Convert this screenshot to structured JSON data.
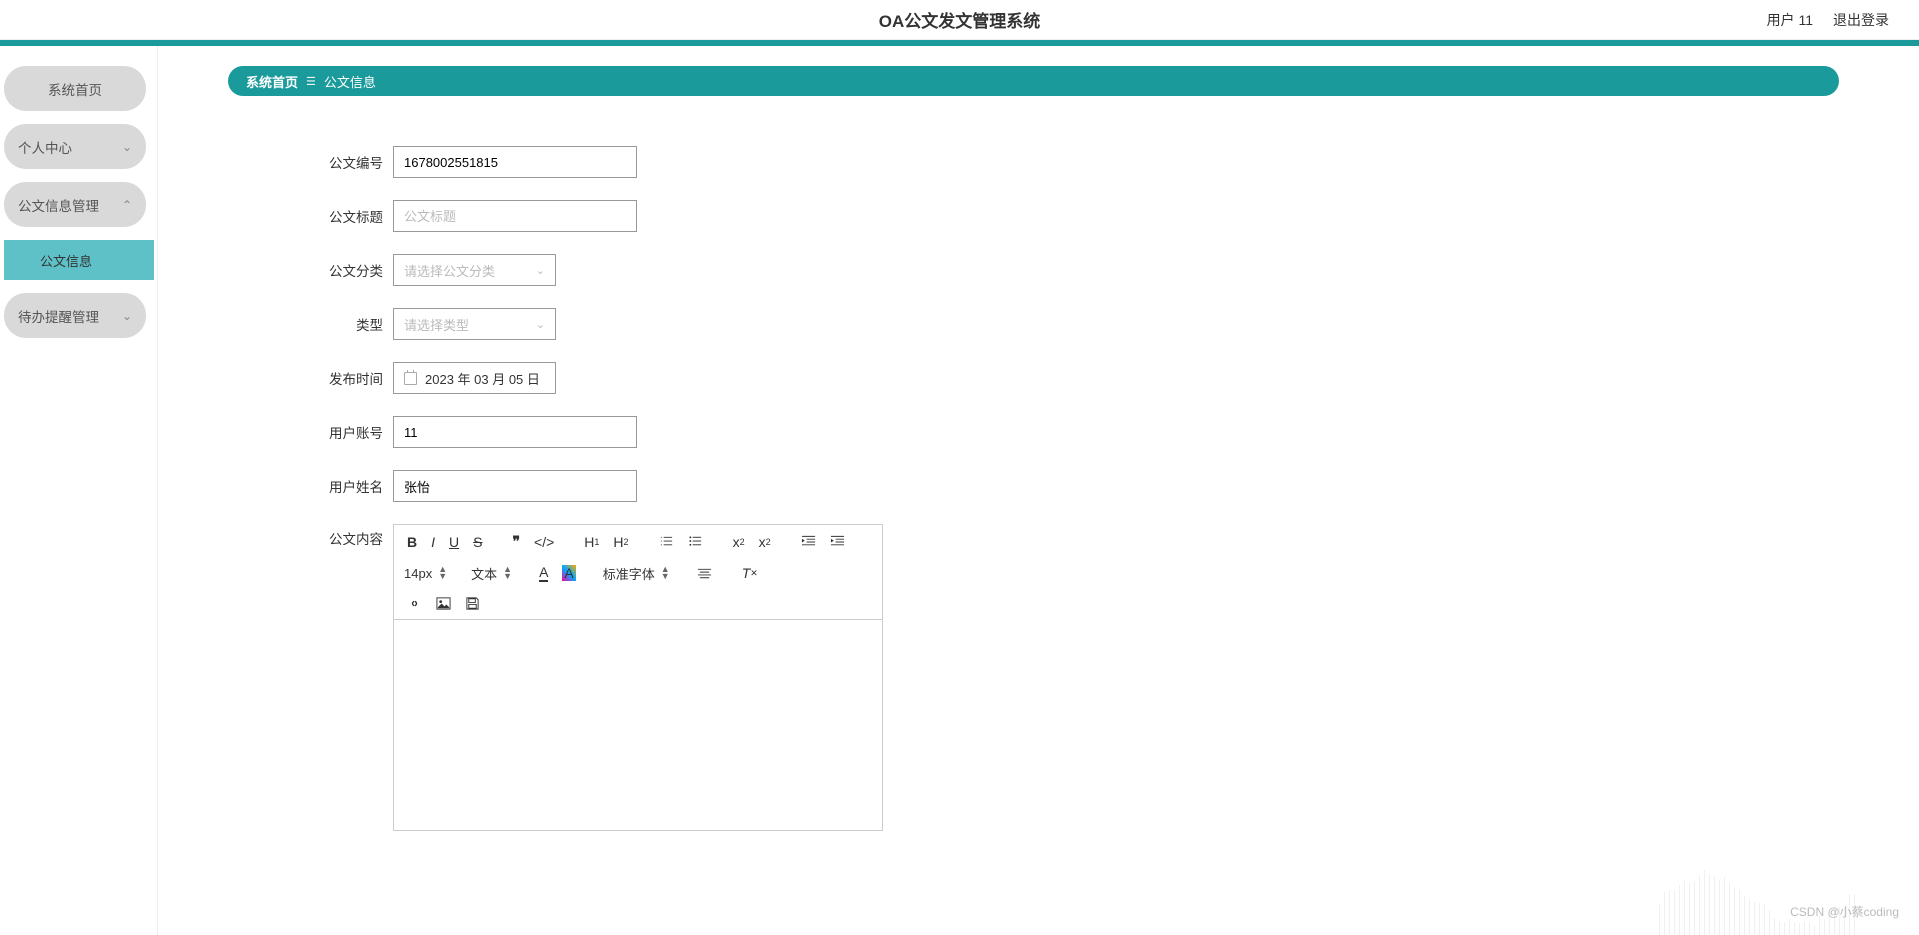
{
  "header": {
    "title": "OA公文发文管理系统",
    "user_label": "用户 11",
    "logout_label": "退出登录"
  },
  "sidebar": {
    "items": [
      {
        "label": "系统首页",
        "type": "pill",
        "expandable": false
      },
      {
        "label": "个人中心",
        "type": "pill",
        "expandable": true,
        "expanded": false
      },
      {
        "label": "公文信息管理",
        "type": "pill",
        "expandable": true,
        "expanded": true
      },
      {
        "label": "公文信息",
        "type": "sub",
        "active": true
      },
      {
        "label": "待办提醒管理",
        "type": "pill",
        "expandable": true,
        "expanded": false
      }
    ]
  },
  "breadcrumb": {
    "home": "系统首页",
    "separator": "☰",
    "current": "公文信息"
  },
  "form": {
    "doc_id": {
      "label": "公文编号",
      "value": "1678002551815"
    },
    "doc_title": {
      "label": "公文标题",
      "placeholder": "公文标题",
      "value": ""
    },
    "doc_category": {
      "label": "公文分类",
      "placeholder": "请选择公文分类"
    },
    "doc_type": {
      "label": "类型",
      "placeholder": "请选择类型"
    },
    "publish_time": {
      "label": "发布时间",
      "value": "2023 年 03 月 05 日"
    },
    "user_account": {
      "label": "用户账号",
      "value": "11"
    },
    "user_name": {
      "label": "用户姓名",
      "value": "张怡"
    },
    "content": {
      "label": "公文内容"
    }
  },
  "editor": {
    "font_size": "14px",
    "format": "文本",
    "font_family": "标准字体"
  },
  "watermark": "CSDN @小蔡coding"
}
